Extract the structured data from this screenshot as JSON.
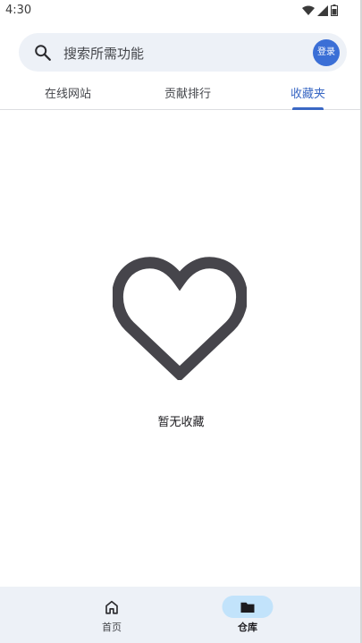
{
  "status_bar": {
    "time": "4:30",
    "icons": [
      "wifi-icon",
      "signal-icon",
      "battery-icon"
    ]
  },
  "search": {
    "placeholder": "搜索所需功能",
    "login_label": "登录"
  },
  "tabs": [
    {
      "label": "在线网站",
      "active": false
    },
    {
      "label": "贡献排行",
      "active": false
    },
    {
      "label": "收藏夹",
      "active": true
    }
  ],
  "empty_state": {
    "icon": "heart-outline-icon",
    "message": "暂无收藏"
  },
  "bottom_nav": [
    {
      "label": "首页",
      "icon": "home-icon",
      "active": false
    },
    {
      "label": "仓库",
      "icon": "folder-icon",
      "active": true
    }
  ],
  "colors": {
    "accent": "#3a68c4",
    "login_button": "#3b6fd6",
    "search_bg": "#edf1f7",
    "nav_pill": "#c2e3fb",
    "heart": "#46454b"
  }
}
